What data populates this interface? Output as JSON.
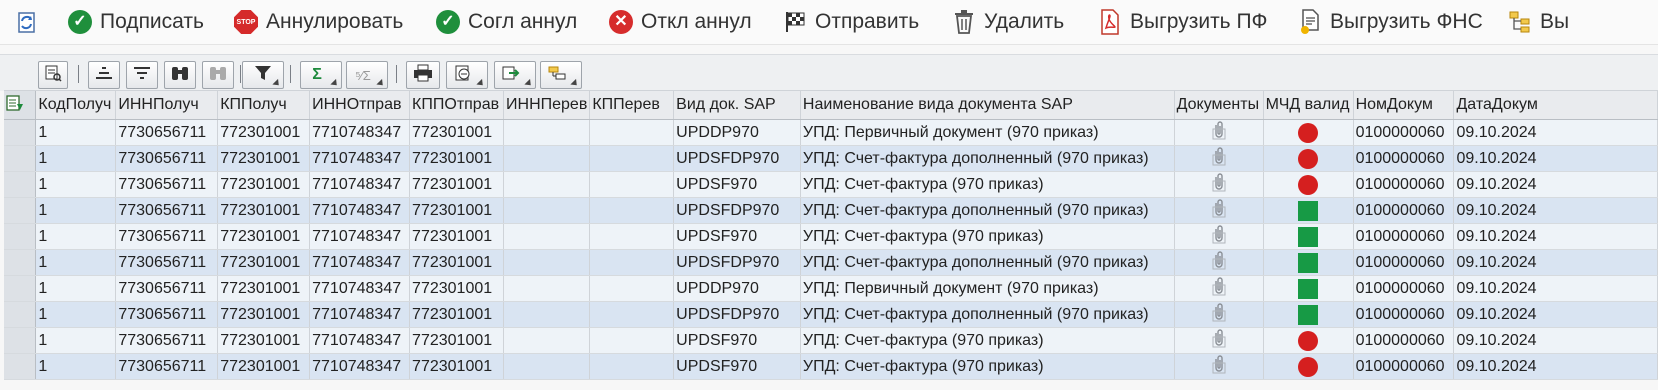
{
  "toolbar": {
    "items": [
      {
        "label": "",
        "icon": "refresh-icon"
      },
      {
        "label": "Подписать",
        "icon": "check-icon"
      },
      {
        "label": "Аннулировать",
        "icon": "stop-icon"
      },
      {
        "label": "Согл аннул",
        "icon": "check-icon"
      },
      {
        "label": "Откл аннул",
        "icon": "cancel-icon"
      },
      {
        "label": "Отправить",
        "icon": "finish-flag-icon"
      },
      {
        "label": "Удалить",
        "icon": "trash-icon"
      },
      {
        "label": "Выгрузить ПФ",
        "icon": "pdf-icon"
      },
      {
        "label": "Выгрузить ФНС",
        "icon": "document-export-icon"
      },
      {
        "label": "Вы",
        "icon": "hierarchy-icon"
      }
    ],
    "stop_text": "STOP",
    "sum_symbol": "Σ",
    "subtotal_symbol": "⁵⁄Σ"
  },
  "table": {
    "columns": [
      "КодПолуч",
      "ИННПолуч",
      "КППолуч",
      "ИННОтправ",
      "КППОтправ",
      "ИННПерев",
      "КППерев",
      "Вид док. SAP",
      "Наименование вида документа SAP",
      "Документы",
      "МЧД валид",
      "НомДокум",
      "ДатаДокум"
    ],
    "rows": [
      {
        "kod": "1",
        "inn_pol": "7730656711",
        "kpp_pol": "772301001",
        "inn_otpr": "7710748347",
        "kpp_otpr": "772301001",
        "inn_perev": "",
        "kpp_perev": "",
        "vid": "UPDDP970",
        "name": "УПД: Первичный документ (970 приказ)",
        "mchd": "red",
        "nom": "0100000060",
        "date": "09.10.2024"
      },
      {
        "kod": "1",
        "inn_pol": "7730656711",
        "kpp_pol": "772301001",
        "inn_otpr": "7710748347",
        "kpp_otpr": "772301001",
        "inn_perev": "",
        "kpp_perev": "",
        "vid": "UPDSFDP970",
        "name": "УПД: Счет-фактура дополненный (970 приказ)",
        "mchd": "red",
        "nom": "0100000060",
        "date": "09.10.2024"
      },
      {
        "kod": "1",
        "inn_pol": "7730656711",
        "kpp_pol": "772301001",
        "inn_otpr": "7710748347",
        "kpp_otpr": "772301001",
        "inn_perev": "",
        "kpp_perev": "",
        "vid": "UPDSF970",
        "name": "УПД: Счет-фактура (970 приказ)",
        "mchd": "red",
        "nom": "0100000060",
        "date": "09.10.2024"
      },
      {
        "kod": "1",
        "inn_pol": "7730656711",
        "kpp_pol": "772301001",
        "inn_otpr": "7710748347",
        "kpp_otpr": "772301001",
        "inn_perev": "",
        "kpp_perev": "",
        "vid": "UPDSFDP970",
        "name": "УПД: Счет-фактура дополненный (970 приказ)",
        "mchd": "green",
        "nom": "0100000060",
        "date": "09.10.2024"
      },
      {
        "kod": "1",
        "inn_pol": "7730656711",
        "kpp_pol": "772301001",
        "inn_otpr": "7710748347",
        "kpp_otpr": "772301001",
        "inn_perev": "",
        "kpp_perev": "",
        "vid": "UPDSF970",
        "name": "УПД: Счет-фактура (970 приказ)",
        "mchd": "green",
        "nom": "0100000060",
        "date": "09.10.2024"
      },
      {
        "kod": "1",
        "inn_pol": "7730656711",
        "kpp_pol": "772301001",
        "inn_otpr": "7710748347",
        "kpp_otpr": "772301001",
        "inn_perev": "",
        "kpp_perev": "",
        "vid": "UPDSFDP970",
        "name": "УПД: Счет-фактура дополненный (970 приказ)",
        "mchd": "green",
        "nom": "0100000060",
        "date": "09.10.2024"
      },
      {
        "kod": "1",
        "inn_pol": "7730656711",
        "kpp_pol": "772301001",
        "inn_otpr": "7710748347",
        "kpp_otpr": "772301001",
        "inn_perev": "",
        "kpp_perev": "",
        "vid": "UPDDP970",
        "name": "УПД: Первичный документ (970 приказ)",
        "mchd": "green",
        "nom": "0100000060",
        "date": "09.10.2024"
      },
      {
        "kod": "1",
        "inn_pol": "7730656711",
        "kpp_pol": "772301001",
        "inn_otpr": "7710748347",
        "kpp_otpr": "772301001",
        "inn_perev": "",
        "kpp_perev": "",
        "vid": "UPDSFDP970",
        "name": "УПД: Счет-фактура дополненный (970 приказ)",
        "mchd": "green",
        "nom": "0100000060",
        "date": "09.10.2024"
      },
      {
        "kod": "1",
        "inn_pol": "7730656711",
        "kpp_pol": "772301001",
        "inn_otpr": "7710748347",
        "kpp_otpr": "772301001",
        "inn_perev": "",
        "kpp_perev": "",
        "vid": "UPDSF970",
        "name": "УПД: Счет-фактура (970 приказ)",
        "mchd": "red",
        "nom": "0100000060",
        "date": "09.10.2024"
      },
      {
        "kod": "1",
        "inn_pol": "7730656711",
        "kpp_pol": "772301001",
        "inn_otpr": "7710748347",
        "kpp_otpr": "772301001",
        "inn_perev": "",
        "kpp_perev": "",
        "vid": "UPDSF970",
        "name": "УПД: Счет-фактура (970 приказ)",
        "mchd": "red",
        "nom": "0100000060",
        "date": "09.10.2024"
      }
    ]
  },
  "colors": {
    "status_red": "#d51f1f",
    "status_green": "#179a45",
    "row_odd": "#eef3f8",
    "row_even": "#d9e4f2"
  }
}
